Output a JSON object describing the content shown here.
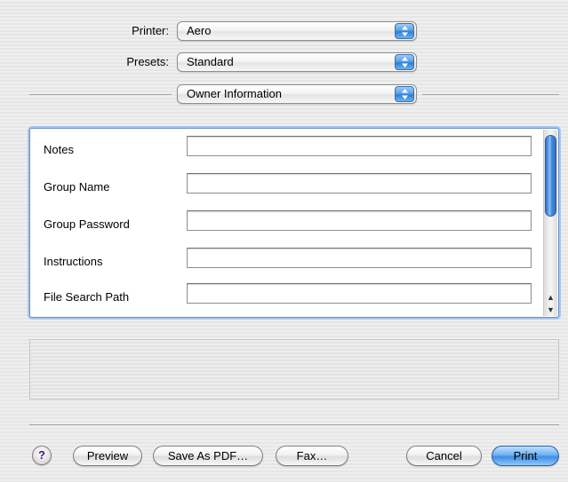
{
  "printer": {
    "label": "Printer:",
    "value": "Aero"
  },
  "presets": {
    "label": "Presets:",
    "value": "Standard"
  },
  "section_popup": {
    "value": "Owner Information"
  },
  "fields": [
    {
      "label": "Notes",
      "value": ""
    },
    {
      "label": "Group Name",
      "value": ""
    },
    {
      "label": "Group Password",
      "value": ""
    },
    {
      "label": "Instructions",
      "value": ""
    },
    {
      "label": "File Search Path",
      "value": ""
    }
  ],
  "buttons": {
    "help": "?",
    "preview": "Preview",
    "save_pdf": "Save As PDF…",
    "fax": "Fax…",
    "cancel": "Cancel",
    "print": "Print"
  },
  "icons": {
    "popup_arrows": "up-down-arrows-icon",
    "scroll_up": "scroll-up-arrow-icon",
    "scroll_down": "scroll-down-arrow-icon"
  },
  "colors": {
    "accent_blue": "#3f8de6",
    "panel_border": "#6a8fc7"
  }
}
